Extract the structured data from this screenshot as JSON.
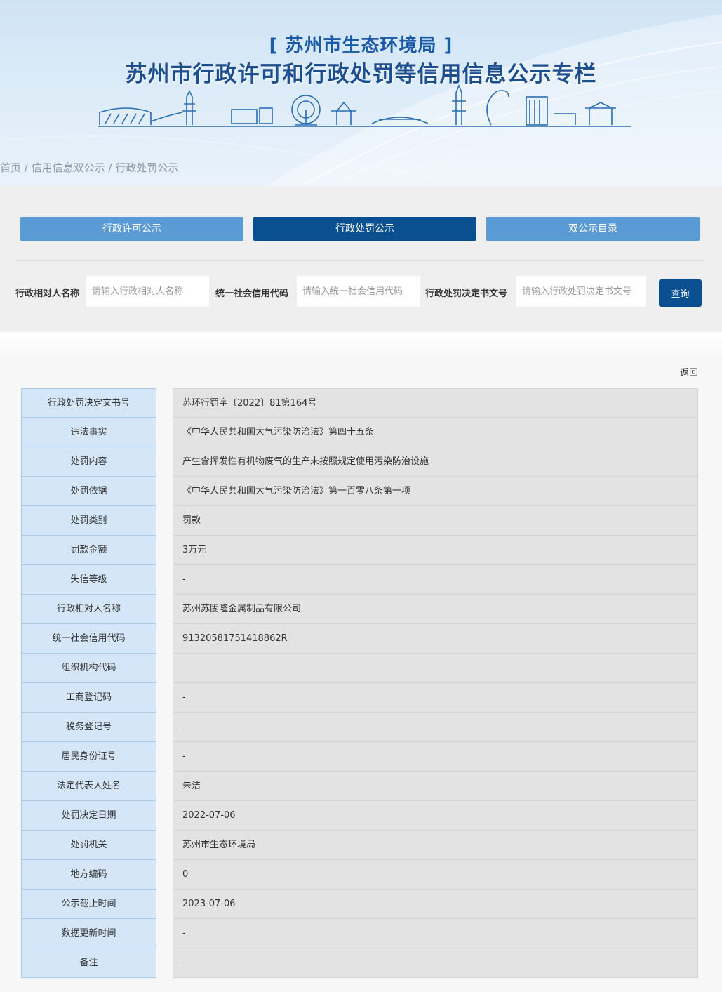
{
  "header": {
    "agency_title": "[ 苏州市生态环境局 ]",
    "column_title": "苏州市行政许可和行政处罚等信用信息公示专栏"
  },
  "breadcrumb": {
    "home": "首页",
    "sep1": " / ",
    "level2": "信用信息双公示",
    "sep2": " / ",
    "level3": "行政处罚公示"
  },
  "tabs": [
    {
      "label": "行政许可公示",
      "active": false
    },
    {
      "label": "行政处罚公示",
      "active": true
    },
    {
      "label": "双公示目录",
      "active": false
    }
  ],
  "search": {
    "name_label": "行政相对人名称",
    "name_placeholder": "请输入行政相对人名称",
    "credit_label": "统一社会信用代码",
    "credit_placeholder": "请输入统一社会信用代码",
    "doc_label": "行政处罚决定书文号",
    "doc_placeholder": "请输入行政处罚决定书文号",
    "query_label": "查询"
  },
  "detail": {
    "back_label": "返回",
    "rows": [
      {
        "key": "行政处罚决定文书号",
        "value": "苏环行罚字〔2022〕81第164号"
      },
      {
        "key": "违法事实",
        "value": "《中华人民共和国大气污染防治法》第四十五条"
      },
      {
        "key": "处罚内容",
        "value": "产生含挥发性有机物废气的生产未按照规定使用污染防治设施"
      },
      {
        "key": "处罚依据",
        "value": "《中华人民共和国大气污染防治法》第一百零八条第一项"
      },
      {
        "key": "处罚类别",
        "value": "罚款"
      },
      {
        "key": "罚款金额",
        "value": "3万元"
      },
      {
        "key": "失信等级",
        "value": "-"
      },
      {
        "key": "行政相对人名称",
        "value": "苏州苏固隆金属制品有限公司"
      },
      {
        "key": "统一社会信用代码",
        "value": "91320581751418862R"
      },
      {
        "key": "组织机构代码",
        "value": "-"
      },
      {
        "key": "工商登记码",
        "value": "-"
      },
      {
        "key": "税务登记号",
        "value": "-"
      },
      {
        "key": "居民身份证号",
        "value": "-"
      },
      {
        "key": "法定代表人姓名",
        "value": "朱洁"
      },
      {
        "key": "处罚决定日期",
        "value": "2022-07-06"
      },
      {
        "key": "处罚机关",
        "value": "苏州市生态环境局"
      },
      {
        "key": "地方编码",
        "value": "0"
      },
      {
        "key": "公示截止时间",
        "value": "2023-07-06"
      },
      {
        "key": "数据更新时间",
        "value": "-"
      },
      {
        "key": "备注",
        "value": "-"
      }
    ]
  },
  "colors": {
    "brand_dark": "#0a4f8f",
    "tab_light": "#5b9bd5",
    "key_cell_bg": "#d4e6f7",
    "value_cell_bg": "#e3e3e3"
  }
}
